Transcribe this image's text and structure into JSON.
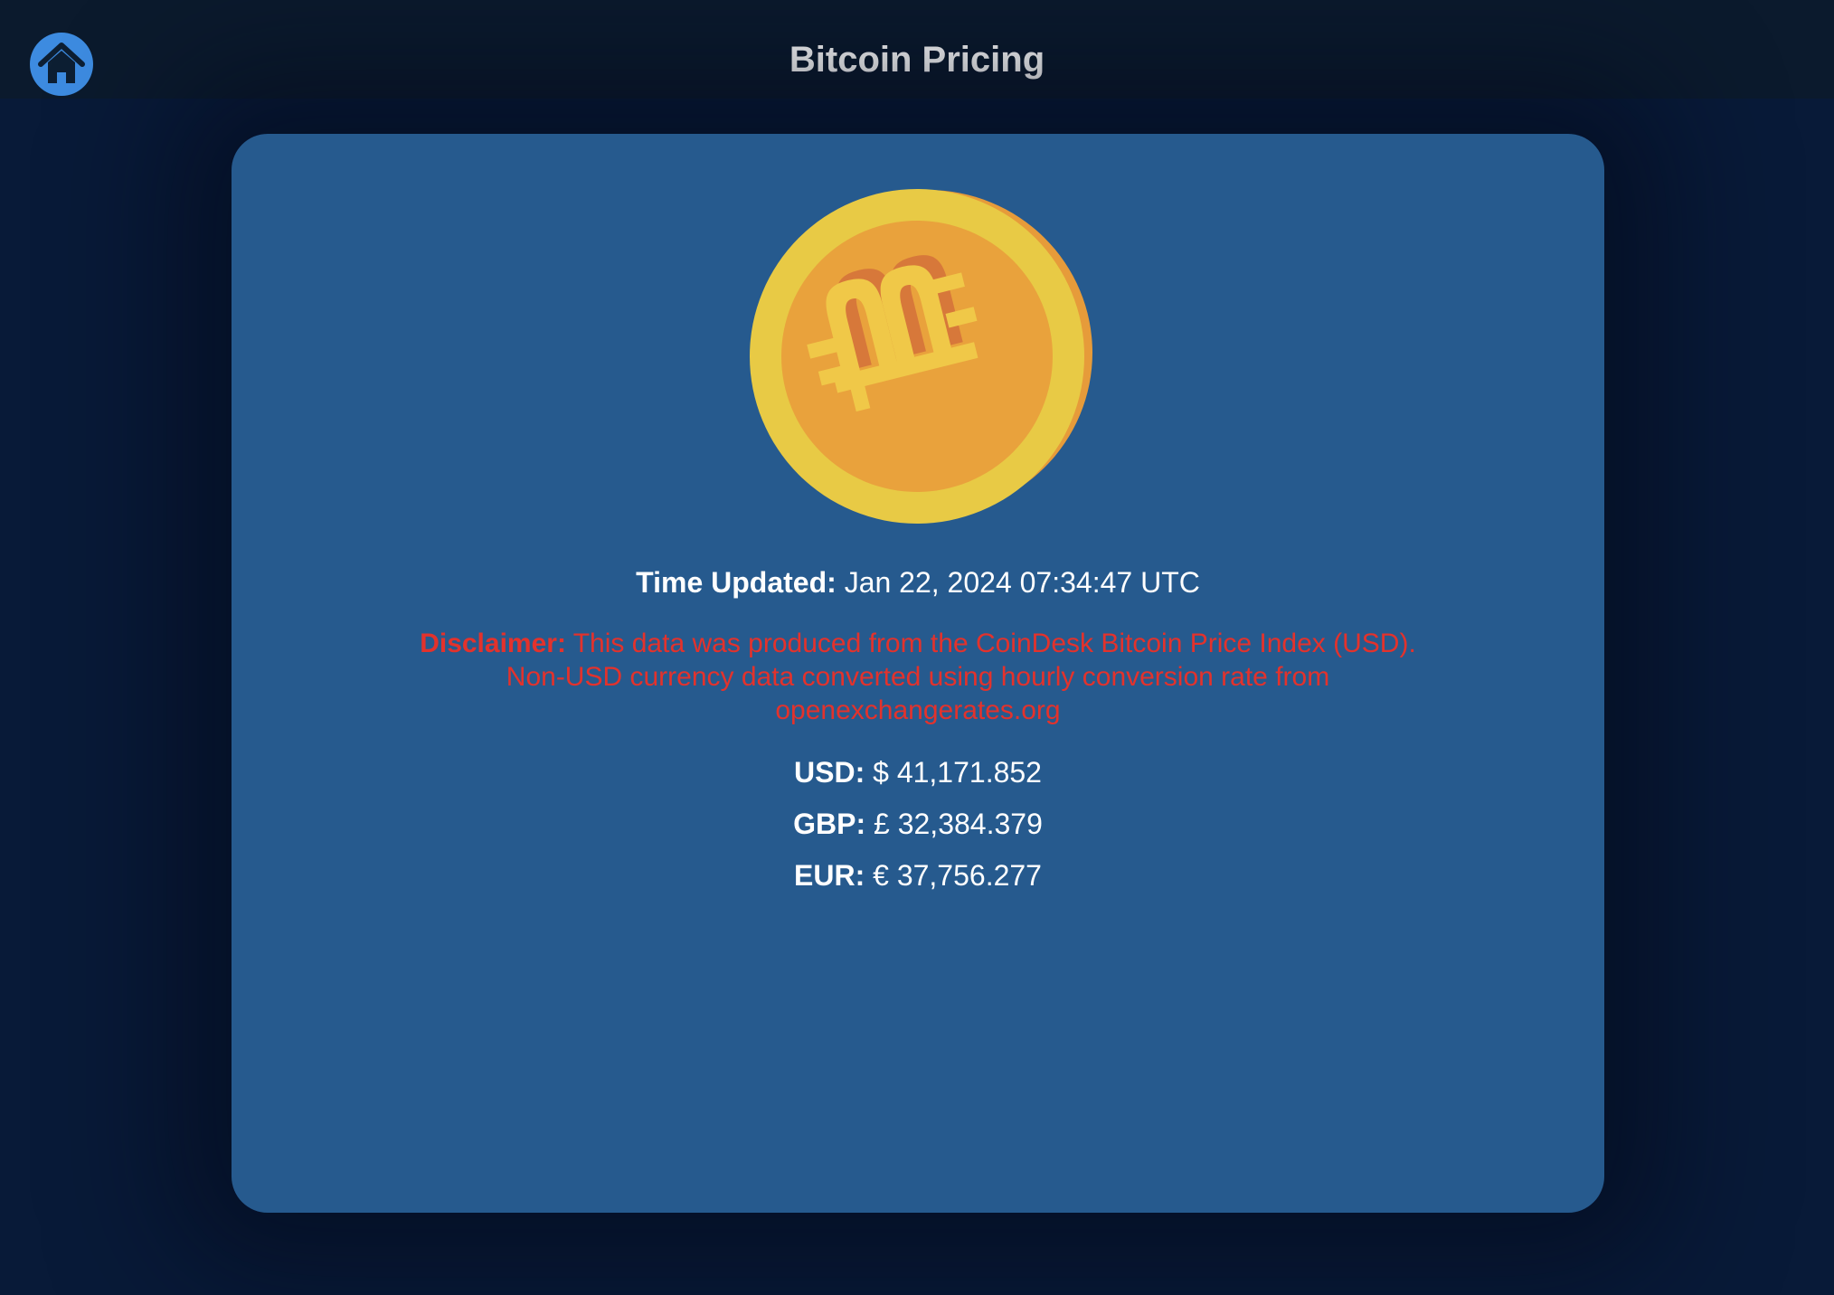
{
  "header": {
    "title": "Bitcoin Pricing",
    "home_icon": "home-icon"
  },
  "coin": {
    "icon": "bitcoin-coin-icon",
    "colors": {
      "rim": "#e8ca45",
      "edge": "#e69b3a",
      "face": "#e9a23c",
      "symbol": "#f0c848",
      "symbol_shadow": "#d7783a"
    }
  },
  "time_updated": {
    "label": "Time Updated:",
    "value": "Jan 22, 2024 07:34:47 UTC"
  },
  "disclaimer": {
    "label": "Disclaimer:",
    "text": "This data was produced from the CoinDesk Bitcoin Price Index (USD). Non-USD currency data converted using hourly conversion rate from openexchangerates.org"
  },
  "prices": [
    {
      "label": "USD:",
      "value": "$ 41,171.852"
    },
    {
      "label": "GBP:",
      "value": "£ 32,384.379"
    },
    {
      "label": "EUR:",
      "value": "€ 37,756.277"
    }
  ],
  "colors": {
    "page_background": "#081a38",
    "header_background": "#0b1a2d",
    "card_background": "#265a8e",
    "home_button": "#3d8be0",
    "disclaimer_text": "#e3322c",
    "text": "#ffffff"
  }
}
